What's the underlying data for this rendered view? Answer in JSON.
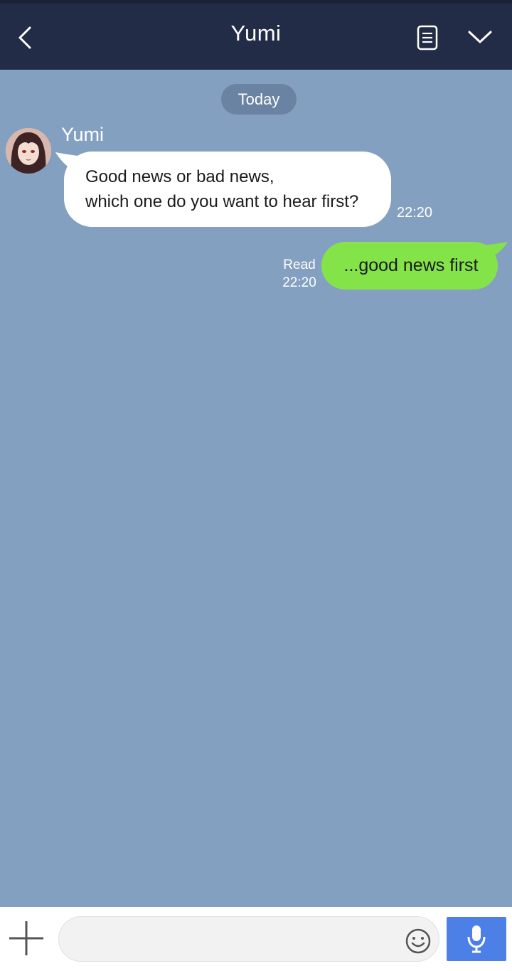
{
  "header": {
    "title": "Yumi",
    "back_icon": "back-arrow-icon",
    "notes_icon": "notes-icon",
    "menu_icon": "chevron-down-icon"
  },
  "chat": {
    "date_divider": "Today",
    "incoming": {
      "sender": "Yumi",
      "lines": [
        "Good news or bad news,",
        "which one do you want to hear first?"
      ],
      "time": "22:20"
    },
    "outgoing": {
      "text": "...good news first",
      "read_label": "Read",
      "time": "22:20"
    }
  },
  "composer": {
    "placeholder": "",
    "plus_icon": "plus-icon",
    "emoji_icon": "emoji-icon",
    "mic_icon": "microphone-icon"
  },
  "colors": {
    "header_bg": "#232c47",
    "chat_bg": "#84a0c0",
    "outgoing_bubble": "#84e349",
    "mic_button": "#4c80e6"
  }
}
